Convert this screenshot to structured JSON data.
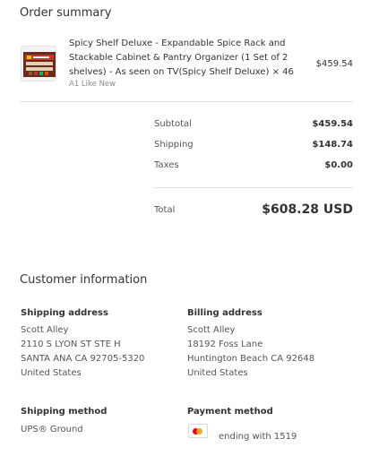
{
  "order_summary": {
    "title": "Order summary",
    "item": {
      "title": "Spicy Shelf Deluxe - Expandable Spice Rack and Stackable Cabinet & Pantry Organizer (1 Set of 2 shelves) - As seen on TV(Spicy Shelf Deluxe) × 46",
      "variant": "A1 Like New",
      "price": "$459.54",
      "image_icon": "product-image-icon"
    },
    "subtotal_label": "Subtotal",
    "subtotal_value": "$459.54",
    "shipping_label": "Shipping",
    "shipping_value": "$148.74",
    "taxes_label": "Taxes",
    "taxes_value": "$0.00",
    "total_label": "Total",
    "total_value": "$608.28 USD"
  },
  "customer_information": {
    "title": "Customer information",
    "shipping_address": {
      "heading": "Shipping address",
      "name": "Scott Alley",
      "line1": "2110 S LYON ST STE H",
      "line2": "SANTA ANA CA 92705-5320",
      "country": "United States"
    },
    "billing_address": {
      "heading": "Billing address",
      "name": "Scott Alley",
      "line1": "18192 Foss Lane",
      "line2": "Huntington Beach CA 92648",
      "country": "United States"
    },
    "shipping_method": {
      "heading": "Shipping method",
      "value": "UPS® Ground"
    },
    "payment_method": {
      "heading": "Payment method",
      "card_icon": "mastercard-icon",
      "value": "ending with 1519"
    }
  }
}
